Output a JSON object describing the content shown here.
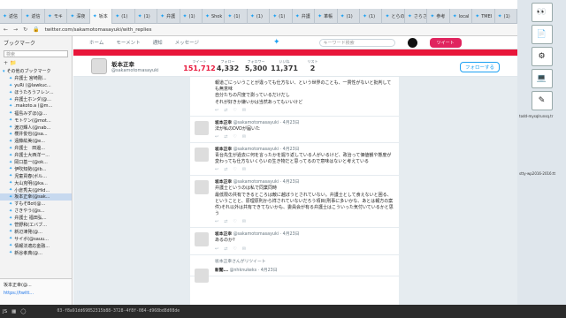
{
  "tabs": [
    {
      "label": "返信"
    },
    {
      "label": "返信"
    },
    {
      "label": "モキ"
    },
    {
      "label": "深夜"
    },
    {
      "label": "坂本"
    },
    {
      "label": "(1)"
    },
    {
      "label": "(1)"
    },
    {
      "label": "弁護"
    },
    {
      "label": "(1)"
    },
    {
      "label": "Shok"
    },
    {
      "label": "(1)"
    },
    {
      "label": "(1)"
    },
    {
      "label": "(1)"
    },
    {
      "label": "弁護"
    },
    {
      "label": "革帳"
    },
    {
      "label": "(1)"
    },
    {
      "label": "(1)"
    },
    {
      "label": "とらの"
    },
    {
      "label": "さらさ"
    },
    {
      "label": "参考"
    },
    {
      "label": "local"
    },
    {
      "label": "TMEI"
    },
    {
      "label": "(1)"
    }
  ],
  "address": {
    "url": "twitter.com/sakamotomasayuki/with_replies"
  },
  "sidebar": {
    "title": "ブックマーク",
    "search_placeholder": "検索",
    "items": [
      {
        "label": "その他のブックマーク",
        "folder": true
      },
      {
        "label": "弁護士 宮崎剛..."
      },
      {
        "label": "yuRi (@lawkuc..."
      },
      {
        "label": "ほうたろうフレン..."
      },
      {
        "label": "弁護士ホンダ(@..."
      },
      {
        "label": ".makoto.a (@m..."
      },
      {
        "label": "福島みずほ(@..."
      },
      {
        "label": "モトケン(@mot..."
      },
      {
        "label": "渡辺輝人(@nab..."
      },
      {
        "label": "櫻井俊也(@sa..."
      },
      {
        "label": "遠藤紘美(@e..."
      },
      {
        "label": "弁護士　田邊..."
      },
      {
        "label": "弁護士大西洋一..."
      },
      {
        "label": "岡口基一(@ok..."
      },
      {
        "label": "伊吹知勢(@ib..."
      },
      {
        "label": "児童買春(ボル..."
      },
      {
        "label": "大山克明(@ka..."
      },
      {
        "label": "小倉秀夫(@Hid..."
      },
      {
        "label": "坂本正幸(@sak...",
        "selected": true
      },
      {
        "label": "すもそBot(@..."
      },
      {
        "label": "さきやう(@s..."
      },
      {
        "label": "弁護士 福田弘..."
      },
      {
        "label": "菅野和(エバブ..."
      },
      {
        "label": "新辺津発(@..."
      },
      {
        "label": "サイボ(@sauu..."
      },
      {
        "label": "情報法適応金融..."
      },
      {
        "label": "新谷孝典(@..."
      }
    ],
    "footer_name": "坂本正幸(@...",
    "footer_link": "https://twitt..."
  },
  "twitter_nav": {
    "home": "ホーム",
    "moments": "モーメント",
    "notifications": "通知",
    "messages": "メッセージ",
    "search_placeholder": "キーワード検索",
    "tweet_button": "ツイート"
  },
  "profile": {
    "name": "坂本正幸",
    "handle": "@sakamotomasayuki",
    "stats": [
      {
        "label": "ツイート",
        "value": "151,712"
      },
      {
        "label": "フォロー",
        "value": "4,332"
      },
      {
        "label": "フォロワー",
        "value": "5,300"
      },
      {
        "label": "いいね",
        "value": "11,371"
      },
      {
        "label": "リスト",
        "value": "2"
      }
    ],
    "follow_button": "フォローする"
  },
  "tweets": [
    {
      "name": "",
      "handle": "",
      "date": "",
      "text": "報道ごにっいうことが違っても仕方ない、という世界のことも、一貫性がないと批判しても無意味\n自分たちの尺度で測っているだけだし\nそれが好きか嫌いかは当然あってもいいけど"
    },
    {
      "name": "坂本正幸",
      "handle": "@sakamotomasayuki",
      "date": "4月23日",
      "text": "法が私のDVDが届いた"
    },
    {
      "name": "坂本正幸",
      "handle": "@sakamotomasayuki",
      "date": "4月23日",
      "text": "青台先生が過去に何を言ったかを掘り返している人がいるけど、政治って価値観や態度が変わっても仕方ないくらいの生き物だと思ってるので意味はないと考えている"
    },
    {
      "name": "坂本正幸",
      "handle": "@sakamotomasayuki",
      "date": "4月23日",
      "text": "弁護士というのは私で同業同時\n最低限の共有できるところは敵に越ぼうとされていない。弁護士として食えないと困る、ということと、原理原則から祥されていないだろう項目(刑事に多いかな、あとは報方の案件)それ以外は共有できてないかも、委員会が有る弁護士はこういった気付いているかと思う"
    },
    {
      "name": "坂本正幸",
      "handle": "@sakamotomasayuki",
      "date": "4月23日",
      "text": "あるのか?"
    }
  ],
  "retweet": {
    "label": "坂本正幸さんがリツイート",
    "name": "新聞...",
    "handle": "@nhknukeks",
    "date": "4月23日"
  },
  "taskbar": {
    "start": "JS",
    "text": "03-f8a91dd69852315b88-3728-4f8f-084-d968bd8d08de"
  },
  "desktop": {
    "labels": [
      "todd-mysqlrunsq.tr",
      "stty-wp2016-2016:tt"
    ]
  }
}
